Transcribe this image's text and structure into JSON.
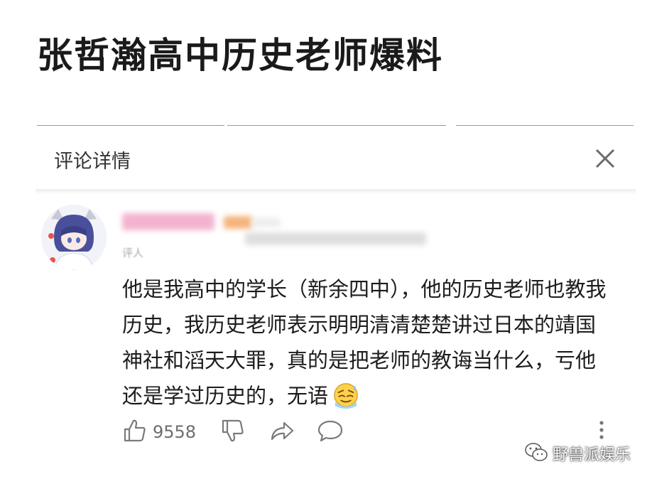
{
  "headline": "张哲瀚高中历史老师爆料",
  "panel": {
    "title": "评论详情"
  },
  "comment": {
    "tag": "评人",
    "text": "他是我高中的学长（新余四中），他的历史老师也教我历史，我历史老师表示明明清清楚楚讲过日本的靖国神社和滔天大罪，真的是把老师的教诲当什么，亏他还是学过历史的，无语",
    "likes": "9558"
  },
  "watermark": "野兽派娱乐",
  "colors": {
    "icon_gray": "#7a7a7a",
    "headline": "#1a1a1a",
    "name_blur": "#f3b3cf"
  }
}
